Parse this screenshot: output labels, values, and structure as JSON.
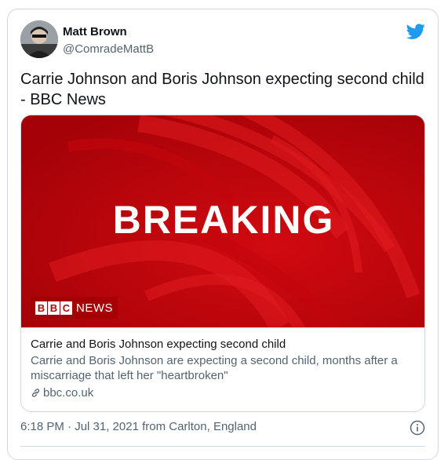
{
  "author": {
    "name": "Matt Brown",
    "handle": "@ComradeMattB",
    "avatar_icon": "user-avatar-photo"
  },
  "tweet": {
    "text": "Carrie Johnson and Boris Johnson expecting second child - BBC News"
  },
  "card": {
    "image_text": "BREAKING",
    "logo_letters": [
      "B",
      "B",
      "C"
    ],
    "logo_word": "NEWS",
    "title": "Carrie and Boris Johnson expecting second child",
    "description": "Carrie and Boris Johnson are expecting a second child, months after a miscarriage that left her \"heartbroken\"",
    "domain": "bbc.co.uk",
    "image_color": "#b8030b"
  },
  "footer": {
    "timestamp": "6:18 PM · Jul 31, 2021 from Carlton, England"
  },
  "colors": {
    "twitter_blue": "#1d9bf0",
    "text_primary": "#0f1419",
    "text_secondary": "#536471"
  }
}
